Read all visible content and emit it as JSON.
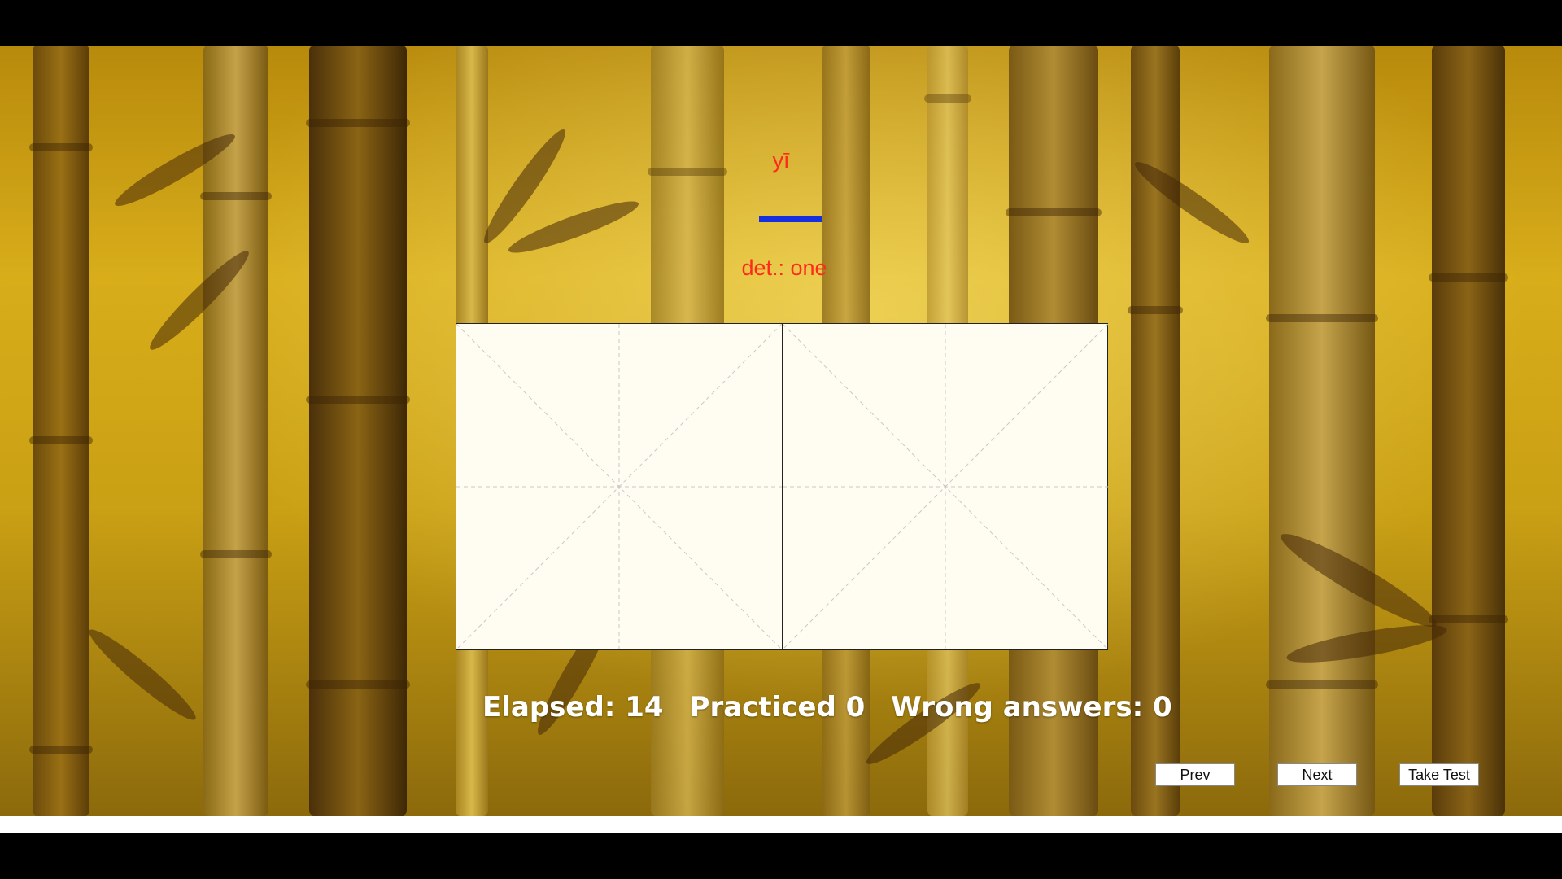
{
  "card": {
    "pinyin": "yī",
    "meaning": "det.: one"
  },
  "stats": {
    "elapsed": "Elapsed: 14",
    "practiced": "Practiced 0",
    "wrong": "Wrong answers: 0"
  },
  "buttons": {
    "prev": "Prev",
    "next": "Next",
    "take_test": "Take Test"
  },
  "colors": {
    "pinyin": "#ff2a1a",
    "stroke": "#1530e0",
    "grid_bg": "#fffcf2"
  }
}
